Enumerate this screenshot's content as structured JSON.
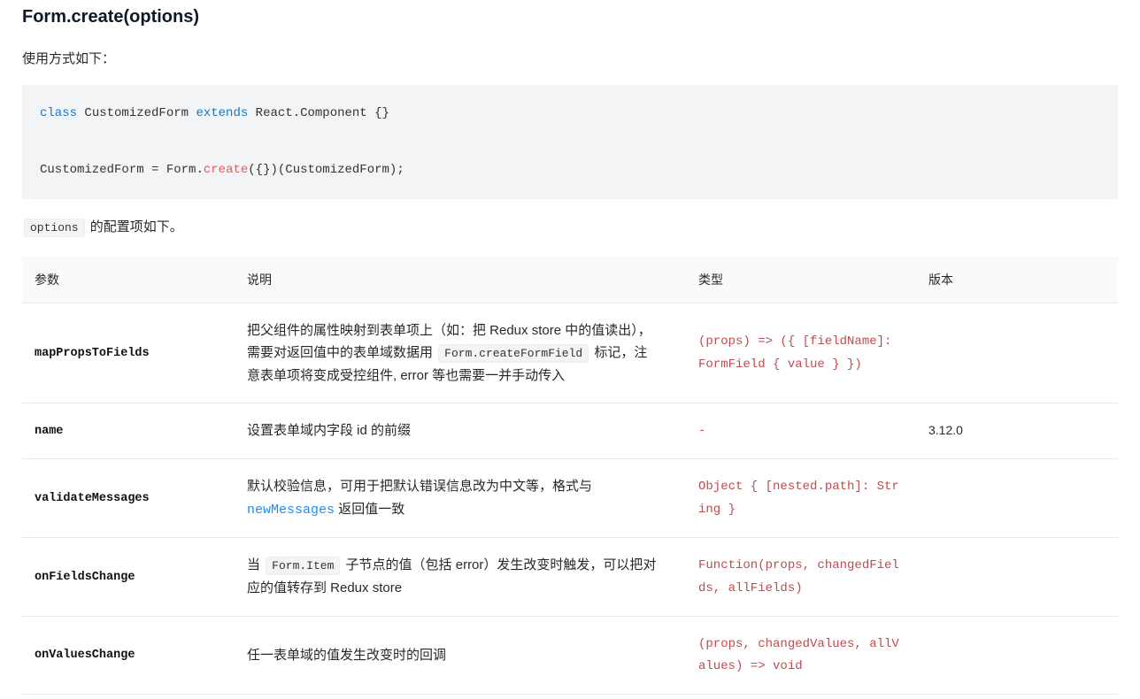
{
  "heading": "Form.create(options)",
  "intro": "使用方式如下：",
  "code": {
    "tokens": [
      {
        "t": "class",
        "c": "tok-kw"
      },
      {
        "t": " ",
        "c": "tok-plain"
      },
      {
        "t": "CustomizedForm ",
        "c": "tok-plain"
      },
      {
        "t": "extends",
        "c": "tok-kw"
      },
      {
        "t": " React",
        "c": "tok-plain"
      },
      {
        "t": ".",
        "c": "tok-punct"
      },
      {
        "t": "Component ",
        "c": "tok-plain"
      },
      {
        "t": "{}",
        "c": "tok-punct"
      },
      {
        "t": "\n\n",
        "c": "tok-plain"
      },
      {
        "t": "CustomizedForm ",
        "c": "tok-plain"
      },
      {
        "t": "=",
        "c": "tok-punct"
      },
      {
        "t": " Form",
        "c": "tok-plain"
      },
      {
        "t": ".",
        "c": "tok-punct"
      },
      {
        "t": "create",
        "c": "tok-func"
      },
      {
        "t": "({})(",
        "c": "tok-punct"
      },
      {
        "t": "CustomizedForm",
        "c": "tok-plain"
      },
      {
        "t": ");",
        "c": "tok-punct"
      }
    ]
  },
  "options_line": {
    "code": "options",
    "suffix": " 的配置项如下。"
  },
  "table": {
    "headers": [
      "参数",
      "说明",
      "类型",
      "版本"
    ],
    "rows": [
      {
        "param": "mapPropsToFields",
        "desc": {
          "parts": [
            {
              "text": "把父组件的属性映射到表单项上（如：把 Redux store 中的值读出），需要对返回值中的表单域数据用 "
            },
            {
              "code": "Form.createFormField"
            },
            {
              "text": " 标记，注意表单项将变成受控组件, error 等也需要一并手动传入"
            }
          ]
        },
        "type": "(props) => ({ [fieldName]: FormField { value } })",
        "version": ""
      },
      {
        "param": "name",
        "desc": {
          "parts": [
            {
              "text": "设置表单域内字段 id 的前缀"
            }
          ]
        },
        "type": "-",
        "version": "3.12.0"
      },
      {
        "param": "validateMessages",
        "desc": {
          "parts": [
            {
              "text": "默认校验信息，可用于把默认错误信息改为中文等，格式与 "
            },
            {
              "link": "newMessages"
            },
            {
              "text": " 返回值一致"
            }
          ]
        },
        "type": "Object { [nested.path]: String }",
        "version": ""
      },
      {
        "param": "onFieldsChange",
        "desc": {
          "parts": [
            {
              "text": "当 "
            },
            {
              "code": "Form.Item"
            },
            {
              "text": " 子节点的值（包括 error）发生改变时触发，可以把对应的值转存到 Redux store"
            }
          ]
        },
        "type": "Function(props, changedFields, allFields)",
        "version": ""
      },
      {
        "param": "onValuesChange",
        "desc": {
          "parts": [
            {
              "text": "任一表单域的值发生改变时的回调"
            }
          ]
        },
        "type": "(props, changedValues, allValues) => void",
        "version": ""
      }
    ]
  }
}
